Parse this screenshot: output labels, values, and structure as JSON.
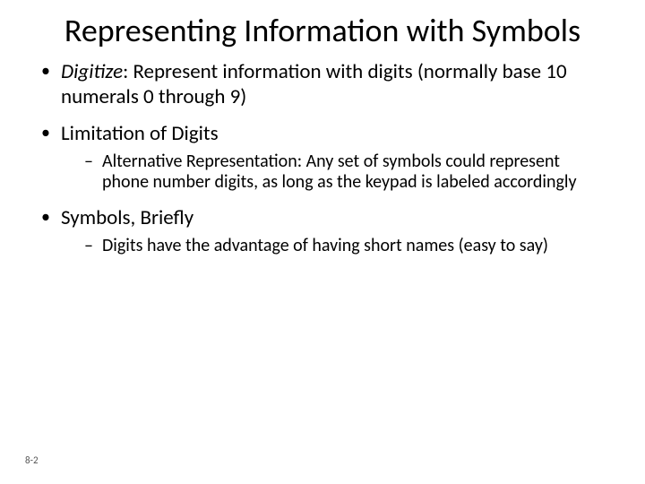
{
  "title": "Representing Information with Symbols",
  "bullets": {
    "b1_term": "Digitize",
    "b1_rest": ":  Represent information with digits (normally base 10 numerals 0 through 9)",
    "b2": "Limitation of Digits",
    "b2_sub": "Alternative Representation: Any set of symbols could represent phone number digits, as long as the keypad is labeled accordingly",
    "b3": "Symbols, Briefly",
    "b3_sub": "Digits have the advantage of having short names (easy to say)"
  },
  "page_number": "8-2"
}
